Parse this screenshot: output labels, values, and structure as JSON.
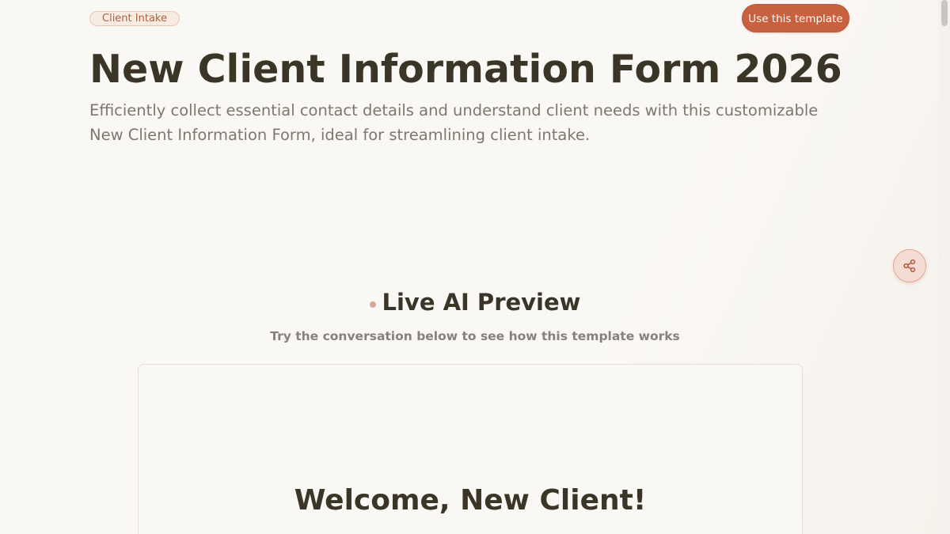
{
  "header": {
    "tag": "Client Intake",
    "cta_label": "Use this template"
  },
  "hero": {
    "title": "New Client Information Form 2026",
    "description": "Efficiently collect essential contact details and understand client needs with this customizable New Client Information Form, ideal for streamlining client intake."
  },
  "share": {
    "icon": "share-icon"
  },
  "preview": {
    "title": "Live AI Preview",
    "subtitle": "Try the conversation below to see how this template works",
    "panel": {
      "welcome_title": "Welcome, New Client!"
    }
  },
  "colors": {
    "accent": "#c8613f",
    "background": "#faf8f5",
    "text": "#3a3527",
    "muted_text": "#7d786e"
  }
}
